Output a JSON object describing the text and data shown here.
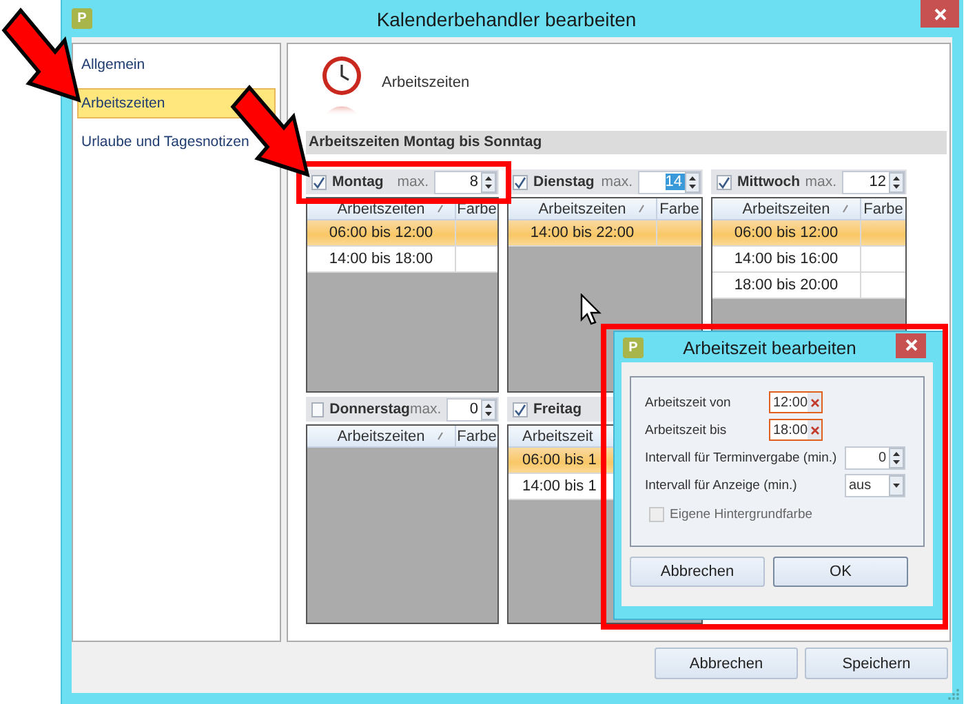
{
  "window": {
    "title": "Kalenderbehandler bearbeiten",
    "icon_label": "P"
  },
  "sidebar": {
    "items": [
      {
        "label": "Allgemein",
        "selected": false
      },
      {
        "label": "Arbeitszeiten",
        "selected": true
      },
      {
        "label": "Urlaube und Tagesnotizen",
        "selected": false
      }
    ]
  },
  "page_header": {
    "title": "Arbeitszeiten"
  },
  "section": {
    "title": "Arbeitszeiten Montag bis Sonntag"
  },
  "days": [
    {
      "name": "Montag",
      "checked": true,
      "max_label": "max.",
      "max": "8",
      "max_selected": false,
      "columns": [
        "Arbeitszeiten",
        "Farbe"
      ],
      "rows": [
        {
          "time": "06:00 bis 12:00",
          "selected": true
        },
        {
          "time": "14:00 bis 18:00",
          "selected": false
        }
      ]
    },
    {
      "name": "Dienstag",
      "checked": true,
      "max_label": "max.",
      "max": "14",
      "max_selected": true,
      "columns": [
        "Arbeitszeiten",
        "Farbe"
      ],
      "rows": [
        {
          "time": "14:00 bis 22:00",
          "selected": true
        }
      ]
    },
    {
      "name": "Mittwoch",
      "checked": true,
      "max_label": "max.",
      "max": "12",
      "max_selected": false,
      "columns": [
        "Arbeitszeiten",
        "Farbe"
      ],
      "rows": [
        {
          "time": "06:00 bis 12:00",
          "selected": true
        },
        {
          "time": "14:00 bis 16:00",
          "selected": false
        },
        {
          "time": "18:00 bis 20:00",
          "selected": false
        }
      ]
    },
    {
      "name": "Donnerstag",
      "checked": false,
      "max_label": "max.",
      "max": "0",
      "max_selected": false,
      "columns": [
        "Arbeitszeiten",
        "Farbe"
      ]
    },
    {
      "name": "Freitag",
      "checked": true,
      "columns": [
        "Arbeitszeit"
      ],
      "rows": [
        {
          "time": "06:00 bis 1",
          "selected": true
        },
        {
          "time": "14:00 bis 1",
          "selected": false
        }
      ]
    }
  ],
  "buttons": [
    {
      "label": "Abbrechen"
    },
    {
      "label": "Speichern"
    }
  ],
  "dialog": {
    "title": "Arbeitszeit bearbeiten",
    "icon_label": "P",
    "fields": [
      {
        "kind": "time",
        "label": "Arbeitszeit von",
        "value": "12:00"
      },
      {
        "kind": "time",
        "label": "Arbeitszeit bis",
        "value": "18:00"
      },
      {
        "kind": "spin",
        "label": "Intervall für Terminvergabe (min.)",
        "value": "0"
      },
      {
        "kind": "dropdown",
        "label": "Intervall für Anzeige (min.)",
        "value": "aus"
      }
    ],
    "checkbox": {
      "label": "Eigene Hintergrundfarbe",
      "checked": false,
      "disabled": true
    },
    "buttons": [
      {
        "label": "Abbrechen",
        "default": false
      },
      {
        "label": "OK",
        "default": true
      }
    ]
  }
}
